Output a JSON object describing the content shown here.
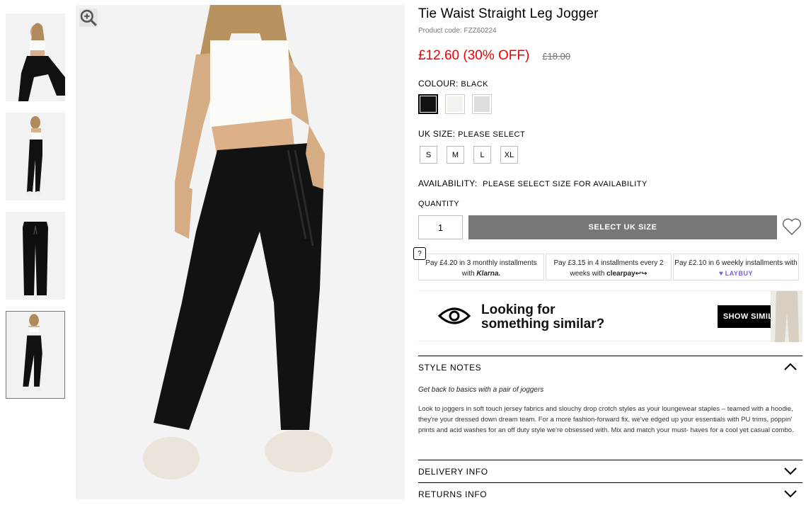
{
  "product": {
    "title": "Tie Waist Straight Leg Jogger",
    "code_label": "Product code: FZZ60224",
    "price_now": "£12.60 (30% OFF)",
    "price_was": "£18.00"
  },
  "colour": {
    "label": "COLOUR:",
    "value": "BLACK",
    "swatches": [
      {
        "name": "black",
        "hex": "#111111"
      },
      {
        "name": "ecru",
        "hex": "#f3f2ee"
      },
      {
        "name": "grey-marl",
        "hex": "#dcdcdc"
      }
    ]
  },
  "size": {
    "label": "UK SIZE:",
    "value": "PLEASE SELECT",
    "options": [
      "S",
      "M",
      "L",
      "XL"
    ]
  },
  "availability": {
    "label": "AVAILABILITY:",
    "value": "PLEASE SELECT SIZE FOR AVAILABILITY"
  },
  "quantity": {
    "label": "QUANTITY",
    "value": "1"
  },
  "cta": {
    "select_size": "SELECT UK SIZE"
  },
  "payments": {
    "help": "?",
    "klarna": {
      "prefix": "Pay ",
      "amount": "£4.20",
      "mid": " in 3 monthly installments with ",
      "brand": "Klarna."
    },
    "clearpay": {
      "prefix": "Pay ",
      "amount": "£3.15",
      "mid": " in 4 installments every 2 weeks with ",
      "brand": "clearpay"
    },
    "laybuy": {
      "prefix": "Pay ",
      "amount": "£2.10",
      "mid": " in 6 weekly installments with ",
      "brand": "LAYBUY"
    }
  },
  "similar": {
    "line1": "Looking for",
    "line2": "something similar?",
    "button": "SHOW SIMILAR"
  },
  "style_notes": {
    "title": "STYLE NOTES",
    "lead": "Get back to basics with a pair of joggers",
    "body": "Look to joggers in soft touch jersey fabrics and slouchy drop crotch styles as your loungewear staples – teamed with a hoodie, they're your dressed down dream team. For a more fashion-forward fix, we've edged up your essentials with PU trims, poppin' prints and acid washes for an off duty style we're obsessed with. Mix and match your must- haves for a cool yet casual combo."
  },
  "delivery": {
    "title": "DELIVERY INFO"
  },
  "returns": {
    "title": "RETURNS INFO"
  },
  "colors": {
    "price_red": "#e00000",
    "button_grey": "#777777",
    "laybuy_purple": "#7b5cd6"
  }
}
